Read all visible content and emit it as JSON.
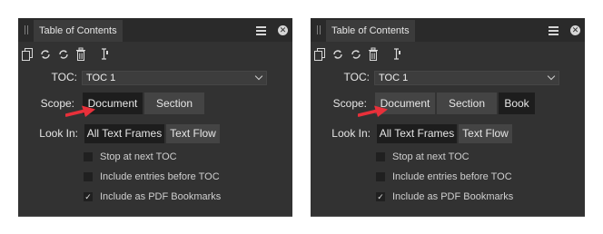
{
  "panels": [
    {
      "title": "Table of Contents",
      "toc_label": "TOC:",
      "toc_value": "TOC 1",
      "scope_label": "Scope:",
      "scope_options": [
        {
          "label": "Document",
          "selected": true
        },
        {
          "label": "Section",
          "selected": false
        }
      ],
      "lookin_label": "Look In:",
      "lookin_options": [
        {
          "label": "All Text Frames",
          "selected": true
        },
        {
          "label": "Text Flow",
          "selected": false
        }
      ],
      "checkboxes": [
        {
          "label": "Stop at next TOC",
          "checked": false
        },
        {
          "label": "Include entries before TOC",
          "checked": false
        },
        {
          "label": "Include as PDF Bookmarks",
          "checked": true
        }
      ]
    },
    {
      "title": "Table of Contents",
      "toc_label": "TOC:",
      "toc_value": "TOC 1",
      "scope_label": "Scope:",
      "scope_options": [
        {
          "label": "Document",
          "selected": false
        },
        {
          "label": "Section",
          "selected": false
        },
        {
          "label": "Book",
          "selected": true
        }
      ],
      "lookin_label": "Look In:",
      "lookin_options": [
        {
          "label": "All Text Frames",
          "selected": true
        },
        {
          "label": "Text Flow",
          "selected": false
        }
      ],
      "checkboxes": [
        {
          "label": "Stop at next TOC",
          "checked": false
        },
        {
          "label": "Include entries before TOC",
          "checked": false
        },
        {
          "label": "Include as PDF Bookmarks",
          "checked": true
        }
      ]
    }
  ],
  "colors": {
    "panel_bg": "#323232",
    "titlebar_bg": "#2a2a2a",
    "selected_bg": "#1d1d1d",
    "unselected_bg": "#444444",
    "annotation_arrow": "#e8303a"
  },
  "icons": [
    "insert-toc-icon",
    "update-icon",
    "refresh-icon",
    "delete-icon",
    "text-cursor-icon",
    "menu-icon",
    "close-icon"
  ]
}
